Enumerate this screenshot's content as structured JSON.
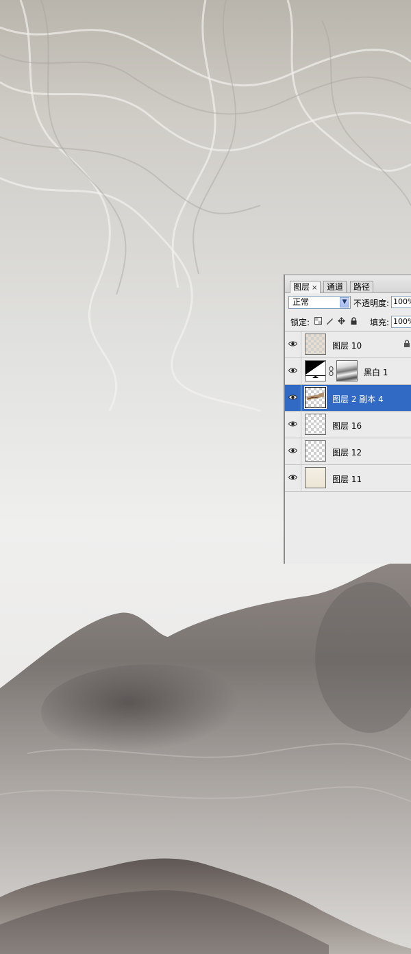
{
  "panel": {
    "tabs": [
      {
        "label": "图层",
        "close": "×",
        "active": true
      },
      {
        "label": "通道",
        "active": false
      },
      {
        "label": "路径",
        "active": false
      }
    ],
    "blend_mode": "正常",
    "opacity_label": "不透明度:",
    "opacity_value": "100%",
    "lock_label": "锁定:",
    "fill_label": "填充:",
    "fill_value": "100%",
    "lock_icons": [
      "lock-transparent-icon",
      "lock-image-icon",
      "lock-position-icon",
      "lock-all-icon"
    ],
    "layers": [
      {
        "name": "图层 10",
        "thumb": "beige-checker",
        "locked": true,
        "selected": false
      },
      {
        "name": "黑白 1",
        "thumb": "adjustment-bw",
        "mask": true,
        "selected": false
      },
      {
        "name": "图层 2 副本 4",
        "thumb": "painting",
        "selected": true
      },
      {
        "name": "图层 16",
        "thumb": "checker",
        "selected": false
      },
      {
        "name": "图层 12",
        "thumb": "checker",
        "selected": false
      },
      {
        "name": "图层 11",
        "thumb": "cream",
        "selected": false
      }
    ]
  },
  "colors": {
    "selection": "#316ac5",
    "panel_bg": "#ebebeb"
  }
}
